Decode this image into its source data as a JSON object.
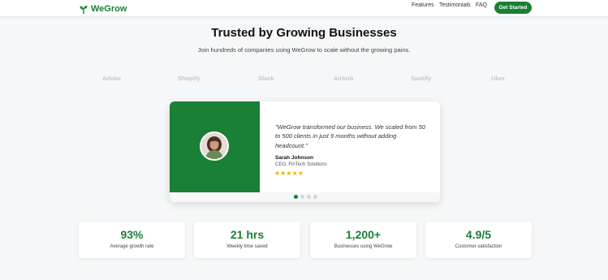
{
  "header": {
    "brand": "WeGrow",
    "nav": [
      "Features",
      "Testimonials",
      "FAQ"
    ],
    "cta_label": "Get Started"
  },
  "hero": {
    "title": "Trusted by Growing Businesses",
    "subtitle": "Join hundreds of companies using WeGrow to scale without the growing pains."
  },
  "logos": [
    "Adobe",
    "Shopify",
    "Slack",
    "Airbnb",
    "Spotify",
    "Uber"
  ],
  "testimonial": {
    "quote": "\"WeGrow transformed our business. We scaled from 50 to 500 clients in just 9 months without adding headcount.\"",
    "author": "Sarah Johnson",
    "author_title": "CEO, FinTech Solutions",
    "stars": "★★★★★",
    "rating": 5,
    "carousel_total": 4,
    "carousel_active": 1
  },
  "stats": [
    {
      "value": "93%",
      "label": "Average growth rate"
    },
    {
      "value": "21 hrs",
      "label": "Weekly time saved"
    },
    {
      "value": "1,200+",
      "label": "Businesses using WeGrow"
    },
    {
      "value": "4.9/5",
      "label": "Customer satisfaction"
    }
  ],
  "colors": {
    "brand_green": "#1a7f37",
    "star_gold": "#f0b400",
    "page_background": "#f6f7f8"
  }
}
